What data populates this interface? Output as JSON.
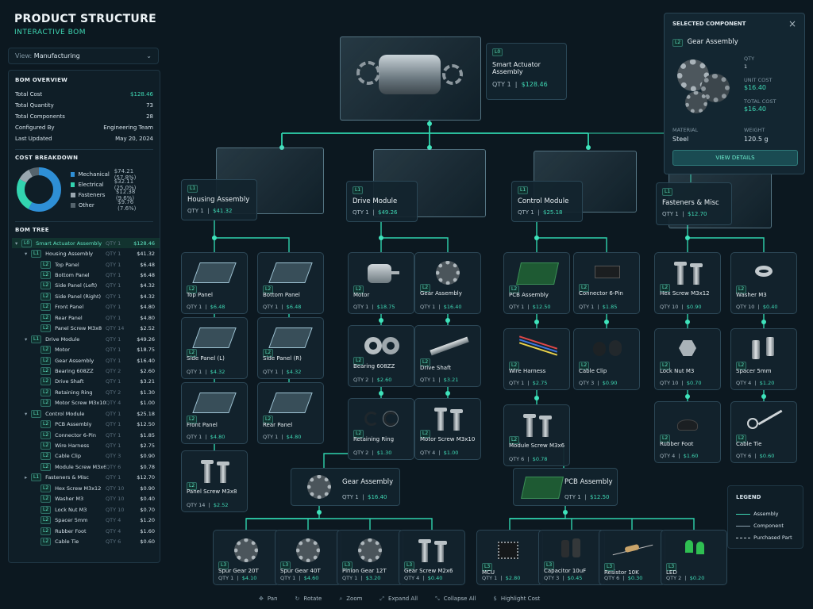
{
  "header": {
    "title": "PRODUCT STRUCTURE",
    "subtitle": "INTERACTIVE BOM"
  },
  "view": {
    "label": "View:",
    "value": "Manufacturing"
  },
  "overview": {
    "title": "BOM OVERVIEW",
    "rows": [
      {
        "k": "Total Cost",
        "v": "$128.46"
      },
      {
        "k": "Total Quantity",
        "v": "73"
      },
      {
        "k": "Total Components",
        "v": "28"
      },
      {
        "k": "Configured By",
        "v": "Engineering Team"
      },
      {
        "k": "Last Updated",
        "v": "May 20, 2024"
      }
    ]
  },
  "cost_breakdown": {
    "title": "COST BREAKDOWN",
    "items": [
      {
        "label": "Mechanical",
        "value": "$74.21 (57.8%)",
        "color": "#2e8fd6",
        "pct": 57.8
      },
      {
        "label": "Electrical",
        "value": "$32.11 (25.0%)",
        "color": "#32d4b0",
        "pct": 25.0
      },
      {
        "label": "Fasteners",
        "value": "$12.38 (9.6%)",
        "color": "#9aa7b0",
        "pct": 9.6
      },
      {
        "label": "Other",
        "value": "$9.76 (7.6%)",
        "color": "#55646d",
        "pct": 7.6
      }
    ]
  },
  "tree": {
    "title": "BOM TREE",
    "rows": [
      {
        "lvl": "L0",
        "name": "Smart Actuator Assembly",
        "q": "QTY 1",
        "c": "$128.46",
        "d": 0,
        "arrow": "▾",
        "sel": true
      },
      {
        "lvl": "L1",
        "name": "Housing Assembly",
        "q": "QTY 1",
        "c": "$41.32",
        "d": 1,
        "arrow": "▾"
      },
      {
        "lvl": "L2",
        "name": "Top Panel",
        "q": "QTY 1",
        "c": "$6.48",
        "d": 2
      },
      {
        "lvl": "L2",
        "name": "Bottom Panel",
        "q": "QTY 1",
        "c": "$6.48",
        "d": 2
      },
      {
        "lvl": "L2",
        "name": "Side Panel (Left)",
        "q": "QTY 1",
        "c": "$4.32",
        "d": 2
      },
      {
        "lvl": "L2",
        "name": "Side Panel (Right)",
        "q": "QTY 1",
        "c": "$4.32",
        "d": 2
      },
      {
        "lvl": "L2",
        "name": "Front Panel",
        "q": "QTY 1",
        "c": "$4.80",
        "d": 2
      },
      {
        "lvl": "L2",
        "name": "Rear Panel",
        "q": "QTY 1",
        "c": "$4.80",
        "d": 2
      },
      {
        "lvl": "L2",
        "name": "Panel Screw M3x8",
        "q": "QTY 14",
        "c": "$2.52",
        "d": 2
      },
      {
        "lvl": "L1",
        "name": "Drive Module",
        "q": "QTY 1",
        "c": "$49.26",
        "d": 1,
        "arrow": "▾"
      },
      {
        "lvl": "L2",
        "name": "Motor",
        "q": "QTY 1",
        "c": "$18.75",
        "d": 2
      },
      {
        "lvl": "L2",
        "name": "Gear Assembly",
        "q": "QTY 1",
        "c": "$16.40",
        "d": 2
      },
      {
        "lvl": "L2",
        "name": "Bearing 608ZZ",
        "q": "QTY 2",
        "c": "$2.60",
        "d": 2
      },
      {
        "lvl": "L2",
        "name": "Drive Shaft",
        "q": "QTY 1",
        "c": "$3.21",
        "d": 2
      },
      {
        "lvl": "L2",
        "name": "Retaining Ring",
        "q": "QTY 2",
        "c": "$1.30",
        "d": 2
      },
      {
        "lvl": "L2",
        "name": "Motor Screw M3x10",
        "q": "QTY 4",
        "c": "$1.00",
        "d": 2
      },
      {
        "lvl": "L1",
        "name": "Control Module",
        "q": "QTY 1",
        "c": "$25.18",
        "d": 1,
        "arrow": "▾"
      },
      {
        "lvl": "L2",
        "name": "PCB Assembly",
        "q": "QTY 1",
        "c": "$12.50",
        "d": 2
      },
      {
        "lvl": "L2",
        "name": "Connector 6-Pin",
        "q": "QTY 1",
        "c": "$1.85",
        "d": 2
      },
      {
        "lvl": "L2",
        "name": "Wire Harness",
        "q": "QTY 1",
        "c": "$2.75",
        "d": 2
      },
      {
        "lvl": "L2",
        "name": "Cable Clip",
        "q": "QTY 3",
        "c": "$0.90",
        "d": 2
      },
      {
        "lvl": "L2",
        "name": "Module Screw M3x6",
        "q": "QTY 6",
        "c": "$0.78",
        "d": 2
      },
      {
        "lvl": "L1",
        "name": "Fasteners & Misc",
        "q": "QTY 1",
        "c": "$12.70",
        "d": 1,
        "arrow": "▸"
      },
      {
        "lvl": "L2",
        "name": "Hex Screw M3x12",
        "q": "QTY 10",
        "c": "$0.90",
        "d": 2
      },
      {
        "lvl": "L2",
        "name": "Washer M3",
        "q": "QTY 10",
        "c": "$0.40",
        "d": 2
      },
      {
        "lvl": "L2",
        "name": "Lock Nut M3",
        "q": "QTY 10",
        "c": "$0.70",
        "d": 2
      },
      {
        "lvl": "L2",
        "name": "Spacer 5mm",
        "q": "QTY 4",
        "c": "$1.20",
        "d": 2
      },
      {
        "lvl": "L2",
        "name": "Rubber Foot",
        "q": "QTY 4",
        "c": "$1.60",
        "d": 2
      },
      {
        "lvl": "L2",
        "name": "Cable Tie",
        "q": "QTY 6",
        "c": "$0.60",
        "d": 2
      }
    ]
  },
  "root": {
    "lvl": "L0",
    "name1": "Smart Actuator",
    "name2": "Assembly",
    "qty": "QTY 1",
    "price": "$128.46"
  },
  "l1": [
    {
      "lvl": "L1",
      "name": "Housing Assembly",
      "qty": "QTY 1",
      "price": "$41.32"
    },
    {
      "lvl": "L1",
      "name": "Drive Module",
      "qty": "QTY 1",
      "price": "$49.26"
    },
    {
      "lvl": "L1",
      "name": "Control Module",
      "qty": "QTY 1",
      "price": "$25.18"
    },
    {
      "lvl": "L1",
      "name": "Fasteners & Misc",
      "qty": "QTY 1",
      "price": "$12.70"
    }
  ],
  "cards": [
    {
      "lvl": "L2",
      "name": "Top Panel",
      "qty": "QTY 1",
      "price": "$6.48",
      "icon": "panel-icon"
    },
    {
      "lvl": "L2",
      "name": "Bottom Panel",
      "qty": "QTY 1",
      "price": "$6.48",
      "icon": "panel-icon"
    },
    {
      "lvl": "L2",
      "name": "Side Panel (L)",
      "qty": "QTY 1",
      "price": "$4.32",
      "icon": "panel-icon"
    },
    {
      "lvl": "L2",
      "name": "Side Panel (R)",
      "qty": "QTY 1",
      "price": "$4.32",
      "icon": "panel-icon"
    },
    {
      "lvl": "L2",
      "name": "Front Panel",
      "qty": "QTY 1",
      "price": "$4.80",
      "icon": "panel-icon"
    },
    {
      "lvl": "L2",
      "name": "Rear Panel",
      "qty": "QTY 1",
      "price": "$4.80",
      "icon": "panel-icon"
    },
    {
      "lvl": "L2",
      "name": "Panel Screw M3x8",
      "qty": "QTY 14",
      "price": "$2.52",
      "icon": "screw-icon"
    },
    {
      "lvl": "L2",
      "name": "Motor",
      "qty": "QTY 1",
      "price": "$18.75",
      "icon": "motor-icon"
    },
    {
      "lvl": "L2",
      "name": "Gear Assembly",
      "qty": "QTY 1",
      "price": "$16.40",
      "icon": "gear-icon"
    },
    {
      "lvl": "L2",
      "name": "Bearing 608ZZ",
      "qty": "QTY 2",
      "price": "$2.60",
      "icon": "bearing-icon"
    },
    {
      "lvl": "L2",
      "name": "Drive Shaft",
      "qty": "QTY 1",
      "price": "$3.21",
      "icon": "shaft-icon"
    },
    {
      "lvl": "L2",
      "name": "Retaining Ring",
      "qty": "QTY 2",
      "price": "$1.30",
      "icon": "ring-icon"
    },
    {
      "lvl": "L2",
      "name": "Motor Screw M3x10",
      "qty": "QTY 4",
      "price": "$1.00",
      "icon": "screw-icon"
    },
    {
      "lvl": "L2",
      "name": "PCB Assembly",
      "qty": "QTY 1",
      "price": "$12.50",
      "icon": "pcb-icon"
    },
    {
      "lvl": "L2",
      "name": "Connector 6-Pin",
      "qty": "QTY 1",
      "price": "$1.85",
      "icon": "connector-icon"
    },
    {
      "lvl": "L2",
      "name": "Wire Harness",
      "qty": "QTY 1",
      "price": "$2.75",
      "icon": "wire-icon"
    },
    {
      "lvl": "L2",
      "name": "Cable Clip",
      "qty": "QTY 3",
      "price": "$0.90",
      "icon": "clip-icon"
    },
    {
      "lvl": "L2",
      "name": "Module Screw M3x6",
      "qty": "QTY 6",
      "price": "$0.78",
      "icon": "screw-icon"
    },
    {
      "lvl": "L2",
      "name": "Hex Screw M3x12",
      "qty": "QTY 10",
      "price": "$0.90",
      "icon": "screw-icon"
    },
    {
      "lvl": "L2",
      "name": "Washer M3",
      "qty": "QTY 10",
      "price": "$0.40",
      "icon": "washer-icon"
    },
    {
      "lvl": "L2",
      "name": "Lock Nut M3",
      "qty": "QTY 10",
      "price": "$0.70",
      "icon": "nut-icon"
    },
    {
      "lvl": "L2",
      "name": "Spacer 5mm",
      "qty": "QTY 4",
      "price": "$1.20",
      "icon": "spacer-icon"
    },
    {
      "lvl": "L2",
      "name": "Rubber Foot",
      "qty": "QTY 4",
      "price": "$1.60",
      "icon": "foot-icon"
    },
    {
      "lvl": "L2",
      "name": "Cable Tie",
      "qty": "QTY 6",
      "price": "$0.60",
      "icon": "tie-icon"
    },
    {
      "lvl": "L3",
      "name": "Spur Gear 20T",
      "qty": "QTY 1",
      "price": "$4.10",
      "icon": "gear-icon"
    },
    {
      "lvl": "L3",
      "name": "Spur Gear 40T",
      "qty": "QTY 1",
      "price": "$4.60",
      "icon": "gear-icon"
    },
    {
      "lvl": "L3",
      "name": "Pinion Gear 12T",
      "qty": "QTY 1",
      "price": "$3.20",
      "icon": "gear-icon"
    },
    {
      "lvl": "L3",
      "name": "Gear Screw M2x6",
      "qty": "QTY 4",
      "price": "$0.40",
      "icon": "screw-icon"
    },
    {
      "lvl": "L3",
      "name": "MCU",
      "qty": "QTY 1",
      "price": "$2.80",
      "icon": "chip-icon"
    },
    {
      "lvl": "L3",
      "name": "Capacitor 10uF",
      "qty": "QTY 3",
      "price": "$0.45",
      "icon": "capacitor-icon"
    },
    {
      "lvl": "L3",
      "name": "Resistor 10K",
      "qty": "QTY 6",
      "price": "$0.30",
      "icon": "resistor-icon"
    },
    {
      "lvl": "L3",
      "name": "LED",
      "qty": "QTY 2",
      "price": "$0.20",
      "icon": "led-icon"
    }
  ],
  "sub": [
    {
      "name": "Gear Assembly",
      "qty": "QTY 1",
      "price": "$16.40"
    },
    {
      "name": "PCB Assembly",
      "qty": "QTY 1",
      "price": "$12.50"
    }
  ],
  "selected": {
    "title": "SELECTED COMPONENT",
    "lvl": "L2",
    "name": "Gear Assembly",
    "qty_label": "QTY",
    "qty": "1",
    "unit_label": "UNIT COST",
    "unit": "$16.40",
    "total_label": "TOTAL COST",
    "total": "$16.40",
    "mat_label": "MATERIAL",
    "mat": "Steel",
    "wt_label": "WEIGHT",
    "wt": "120.5 g",
    "button": "VIEW DETAILS",
    "close": "×"
  },
  "legend": {
    "title": "LEGEND",
    "items": [
      "Assembly",
      "Component",
      "Purchased Part"
    ]
  },
  "toolbar": [
    {
      "label": "Pan",
      "icon": "pan-icon",
      "g": "✥"
    },
    {
      "label": "Rotate",
      "icon": "rotate-icon",
      "g": "↻"
    },
    {
      "label": "Zoom",
      "icon": "zoom-icon",
      "g": "⌕"
    },
    {
      "label": "Expand All",
      "icon": "expand-icon",
      "g": "⤢"
    },
    {
      "label": "Collapse All",
      "icon": "collapse-icon",
      "g": "⤡"
    },
    {
      "label": "Highlight Cost",
      "icon": "cost-icon",
      "g": "$"
    }
  ]
}
